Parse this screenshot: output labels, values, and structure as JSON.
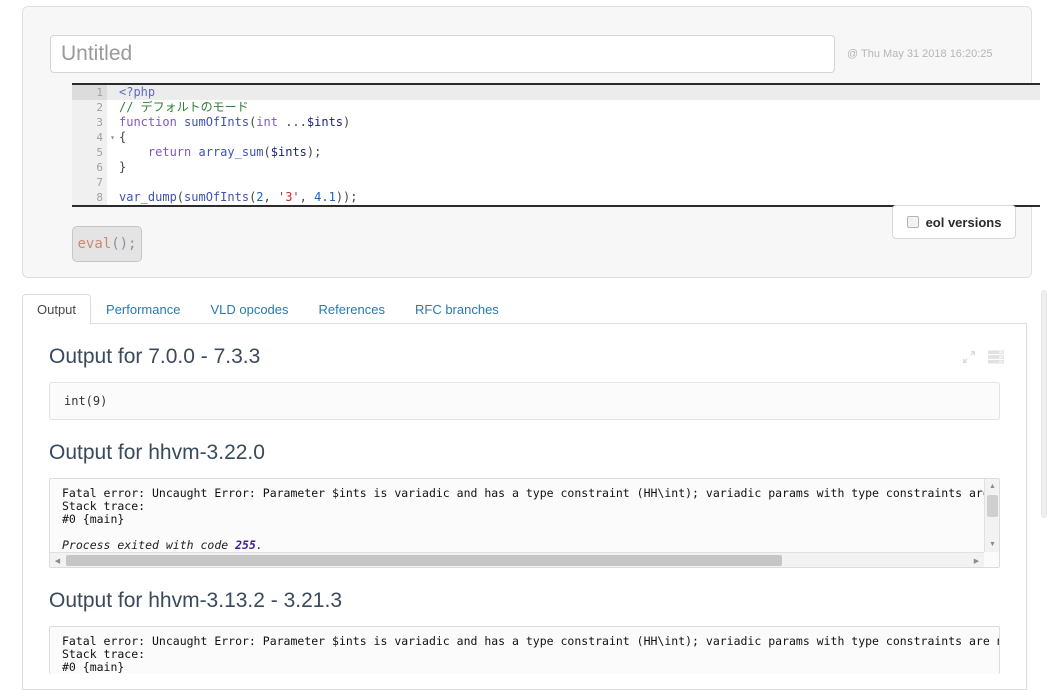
{
  "editor": {
    "title_value": "",
    "title_placeholder": "Untitled",
    "timestamp": "@ Thu May 31 2018 16:20:25",
    "eval_button": {
      "name": "eval",
      "parens": "();"
    },
    "eol_versions_label": "eol versions",
    "eol_versions_checked": false,
    "code_lines": [
      {
        "number": "1",
        "fold": "",
        "active": true,
        "tokens": [
          {
            "t": "<?php",
            "c": "tok-tag"
          }
        ]
      },
      {
        "number": "2",
        "fold": "",
        "active": false,
        "tokens": [
          {
            "t": "// デフォルトのモード",
            "c": "tok-comment"
          }
        ]
      },
      {
        "number": "3",
        "fold": "",
        "active": false,
        "tokens": [
          {
            "t": "function",
            "c": "tok-keyword"
          },
          {
            "t": " ",
            "c": "tok-plain"
          },
          {
            "t": "sumOfInts",
            "c": "tok-func"
          },
          {
            "t": "(",
            "c": "tok-punct"
          },
          {
            "t": "int",
            "c": "tok-type"
          },
          {
            "t": " ...",
            "c": "tok-punct"
          },
          {
            "t": "$ints",
            "c": "tok-var"
          },
          {
            "t": ")",
            "c": "tok-punct"
          }
        ]
      },
      {
        "number": "4",
        "fold": "▾",
        "active": false,
        "tokens": [
          {
            "t": "{",
            "c": "tok-punct"
          }
        ]
      },
      {
        "number": "5",
        "fold": "",
        "active": false,
        "tokens": [
          {
            "t": "    ",
            "c": "tok-plain"
          },
          {
            "t": "return",
            "c": "tok-keyword"
          },
          {
            "t": " ",
            "c": "tok-plain"
          },
          {
            "t": "array_sum",
            "c": "tok-func"
          },
          {
            "t": "(",
            "c": "tok-punct"
          },
          {
            "t": "$ints",
            "c": "tok-var"
          },
          {
            "t": ");",
            "c": "tok-punct"
          }
        ]
      },
      {
        "number": "6",
        "fold": "",
        "active": false,
        "tokens": [
          {
            "t": "}",
            "c": "tok-punct"
          }
        ]
      },
      {
        "number": "7",
        "fold": "",
        "active": false,
        "tokens": [
          {
            "t": "",
            "c": "tok-plain"
          }
        ]
      },
      {
        "number": "8",
        "fold": "",
        "active": false,
        "tokens": [
          {
            "t": "var_dump",
            "c": "tok-func"
          },
          {
            "t": "(",
            "c": "tok-punct"
          },
          {
            "t": "sumOfInts",
            "c": "tok-func"
          },
          {
            "t": "(",
            "c": "tok-punct"
          },
          {
            "t": "2",
            "c": "tok-num"
          },
          {
            "t": ", ",
            "c": "tok-punct"
          },
          {
            "t": "'3'",
            "c": "tok-str"
          },
          {
            "t": ", ",
            "c": "tok-punct"
          },
          {
            "t": "4.1",
            "c": "tok-num"
          },
          {
            "t": "));",
            "c": "tok-punct"
          }
        ]
      }
    ]
  },
  "tabs": [
    {
      "label": "Output",
      "active": true
    },
    {
      "label": "Performance",
      "active": false
    },
    {
      "label": "VLD opcodes",
      "active": false
    },
    {
      "label": "References",
      "active": false
    },
    {
      "label": "RFC branches",
      "active": false
    }
  ],
  "head_icons": {
    "expand": "expand-icon",
    "list": "list-icon"
  },
  "outputs": [
    {
      "heading": "Output for 7.0.0 - 7.3.3",
      "kind": "simple",
      "body": "int(9)"
    },
    {
      "heading": "Output for hhvm-3.22.0",
      "kind": "scroll",
      "body_lines": [
        "Fatal error: Uncaught Error: Parameter $ints is variadic and has a type constraint (HH\\int); variadic params with type constraints are not suppo",
        "Stack trace:",
        "#0 {main}"
      ],
      "exit_prefix": "Process exited with code ",
      "exit_code": "255",
      "exit_suffix": "."
    },
    {
      "heading": "Output for hhvm-3.13.2 - 3.21.3",
      "kind": "scroll-partial",
      "body_lines": [
        "Fatal error: Uncaught Error: Parameter $ints is variadic and has a type constraint (HH\\int); variadic params with type constraints are not suppo",
        "Stack trace:",
        "#0 {main}"
      ]
    }
  ],
  "scroll_arrows": {
    "up": "▲",
    "down": "▼",
    "left": "◀",
    "right": "▶"
  }
}
